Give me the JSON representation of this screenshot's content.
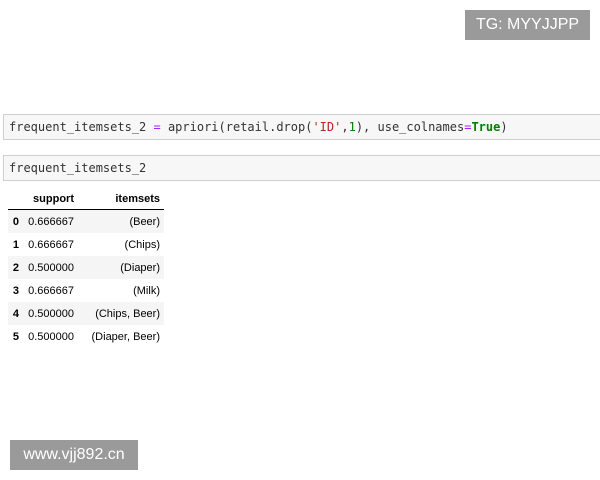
{
  "watermarks": {
    "top": "TG: MYYJJPP",
    "bottom": "www.vjj892.cn"
  },
  "cells": {
    "code1": {
      "prefix": "frequent_itemsets_2 ",
      "op": "=",
      "mid": " apriori(retail.drop(",
      "str": "'ID'",
      "comma": ",",
      "num": "1",
      "after": "), use_colnames",
      "eq": "=",
      "kw": "True",
      "close": ")"
    },
    "code2": "frequent_itemsets_2"
  },
  "table": {
    "columns": [
      "",
      "support",
      "itemsets"
    ],
    "rows": [
      {
        "index": "0",
        "support": "0.666667",
        "itemsets": "(Beer)"
      },
      {
        "index": "1",
        "support": "0.666667",
        "itemsets": "(Chips)"
      },
      {
        "index": "2",
        "support": "0.500000",
        "itemsets": "(Diaper)"
      },
      {
        "index": "3",
        "support": "0.666667",
        "itemsets": "(Milk)"
      },
      {
        "index": "4",
        "support": "0.500000",
        "itemsets": "(Chips, Beer)"
      },
      {
        "index": "5",
        "support": "0.500000",
        "itemsets": "(Diaper, Beer)"
      }
    ]
  }
}
